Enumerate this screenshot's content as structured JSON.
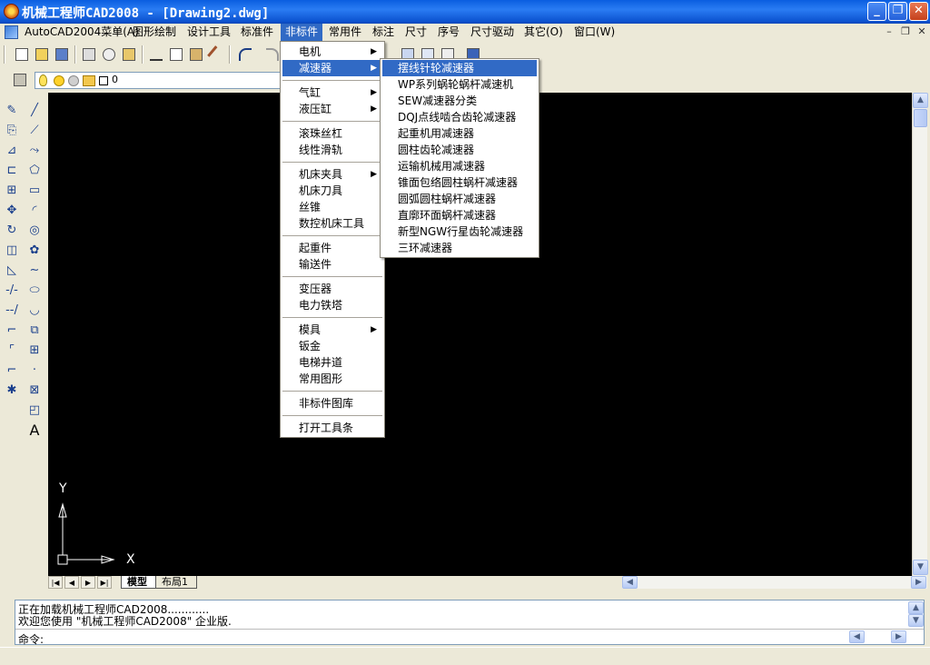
{
  "window": {
    "title": "机械工程师CAD2008 - [Drawing2.dwg]",
    "min_glyph": "_",
    "max_glyph": "❐",
    "close_glyph": "✕"
  },
  "menubar": {
    "items": [
      {
        "label": "AutoCAD2004菜单(A)"
      },
      {
        "label": "图形绘制"
      },
      {
        "label": "设计工具"
      },
      {
        "label": "标准件"
      },
      {
        "label": "非标件"
      },
      {
        "label": "常用件"
      },
      {
        "label": "标注"
      },
      {
        "label": "尺寸"
      },
      {
        "label": "序号"
      },
      {
        "label": "尺寸驱动"
      },
      {
        "label": "其它(O)"
      },
      {
        "label": "窗口(W)"
      }
    ],
    "doc_min": "–",
    "doc_restore": "❐",
    "doc_close": "✕"
  },
  "toolbar2": {
    "layer_name": "0"
  },
  "nonstd_menu": {
    "items": [
      {
        "label": "电机",
        "submenu": true
      },
      {
        "label": "减速器",
        "submenu": true
      },
      {
        "label": "气缸",
        "submenu": true
      },
      {
        "label": "液压缸",
        "submenu": true
      },
      {
        "label": "滚珠丝杠",
        "submenu": false
      },
      {
        "label": "线性滑轨",
        "submenu": false
      },
      {
        "label": "机床夹具",
        "submenu": true
      },
      {
        "label": "机床刀具",
        "submenu": false
      },
      {
        "label": "丝锥",
        "submenu": false
      },
      {
        "label": "数控机床工具",
        "submenu": false
      },
      {
        "label": "起重件",
        "submenu": false
      },
      {
        "label": "输送件",
        "submenu": false
      },
      {
        "label": "变压器",
        "submenu": false
      },
      {
        "label": "电力铁塔",
        "submenu": false
      },
      {
        "label": "模具",
        "submenu": true
      },
      {
        "label": "钣金",
        "submenu": false
      },
      {
        "label": "电梯井道",
        "submenu": false
      },
      {
        "label": "常用图形",
        "submenu": false
      },
      {
        "label": "非标件图库",
        "submenu": false
      },
      {
        "label": "打开工具条",
        "submenu": false
      }
    ],
    "arrow_glyph": "▶"
  },
  "reducer_menu": {
    "items": [
      {
        "label": "摆线针轮减速器"
      },
      {
        "label": "WP系列蜗轮蜗杆减速机"
      },
      {
        "label": "SEW减速器分类"
      },
      {
        "label": "DQJ点线啮合齿轮减速器"
      },
      {
        "label": "起重机用减速器"
      },
      {
        "label": "圆柱齿轮减速器"
      },
      {
        "label": "运输机械用减速器"
      },
      {
        "label": "锥面包络圆柱蜗杆减速器"
      },
      {
        "label": "圆弧圆柱蜗杆减速器"
      },
      {
        "label": "直廓环面蜗杆减速器"
      },
      {
        "label": "新型NGW行星齿轮减速器"
      },
      {
        "label": "三环减速器"
      }
    ]
  },
  "ucs": {
    "x_label": "X",
    "y_label": "Y"
  },
  "layout_tabs": {
    "model": "模型",
    "layout1": "布局1"
  },
  "command": {
    "line1": "正在加载机械工程师CAD2008............",
    "line2": "欢迎您使用 \"机械工程师CAD2008\" 企业版.",
    "prompt": "命令:"
  },
  "colors": {
    "titlebar": "#0a5ee0",
    "menu_highlight": "#316ac5",
    "canvas": "#000000"
  },
  "tool_icons": {
    "strip1": [
      "erase-icon",
      "copy-icon",
      "mirror-icon",
      "offset-icon",
      "array-icon",
      "move-icon",
      "rotate-icon",
      "scale-icon",
      "stretch-icon",
      "trim-icon",
      "extend-icon",
      "break-icon",
      "chamfer-icon",
      "fillet-icon",
      "explode-icon"
    ],
    "strip2": [
      "line-icon",
      "construction-line-icon",
      "polyline-icon",
      "polygon-icon",
      "rectangle-icon",
      "arc-icon",
      "circle-icon",
      "revcloud-icon",
      "spline-icon",
      "ellipse-icon",
      "ellipse-arc-icon",
      "insert-block-icon",
      "make-block-icon",
      "point-icon",
      "hatch-icon",
      "region-icon",
      "text-icon"
    ]
  },
  "text_tool_glyph": "A"
}
